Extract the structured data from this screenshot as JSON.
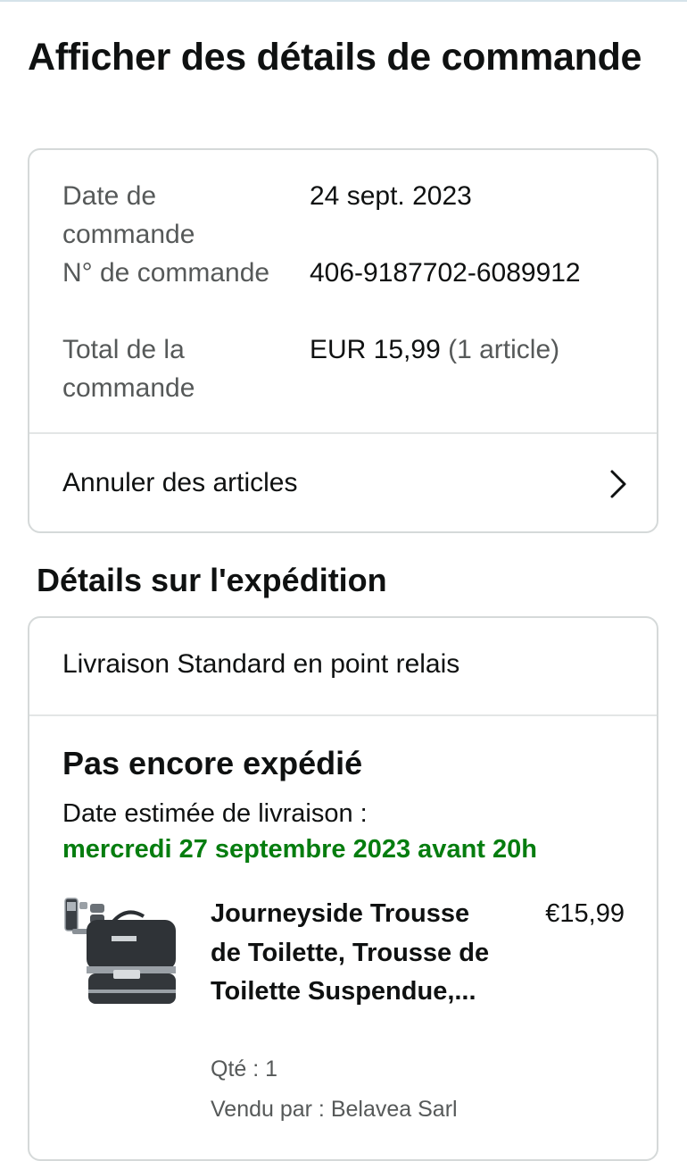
{
  "page": {
    "title": "Afficher des détails de commande"
  },
  "summary": {
    "date_label": "Date de commande",
    "date_value": "24 sept. 2023",
    "number_label": "N° de commande",
    "number_value": "406-9187702-6089912",
    "total_label": "Total de la commande",
    "total_value": "EUR 15,99",
    "total_count": "(1 article)",
    "cancel_label": "Annuler des articles",
    "cancel_icon": "chevron-right-icon"
  },
  "shipping": {
    "section_title": "Détails sur l'expédition",
    "method": "Livraison Standard en point relais",
    "status": "Pas encore expédié",
    "eta_label": "Date estimée de livraison :",
    "eta_value": "mercredi 27 septembre 2023 avant 20h",
    "eta_color": "#067d0f",
    "item": {
      "title": "Journeyside Trousse de Toilette, Trousse de Toilette Suspendue,...",
      "price": "€15,99",
      "quantity": "Qté : 1",
      "seller": "Vendu par : Belavea Sarl"
    }
  }
}
